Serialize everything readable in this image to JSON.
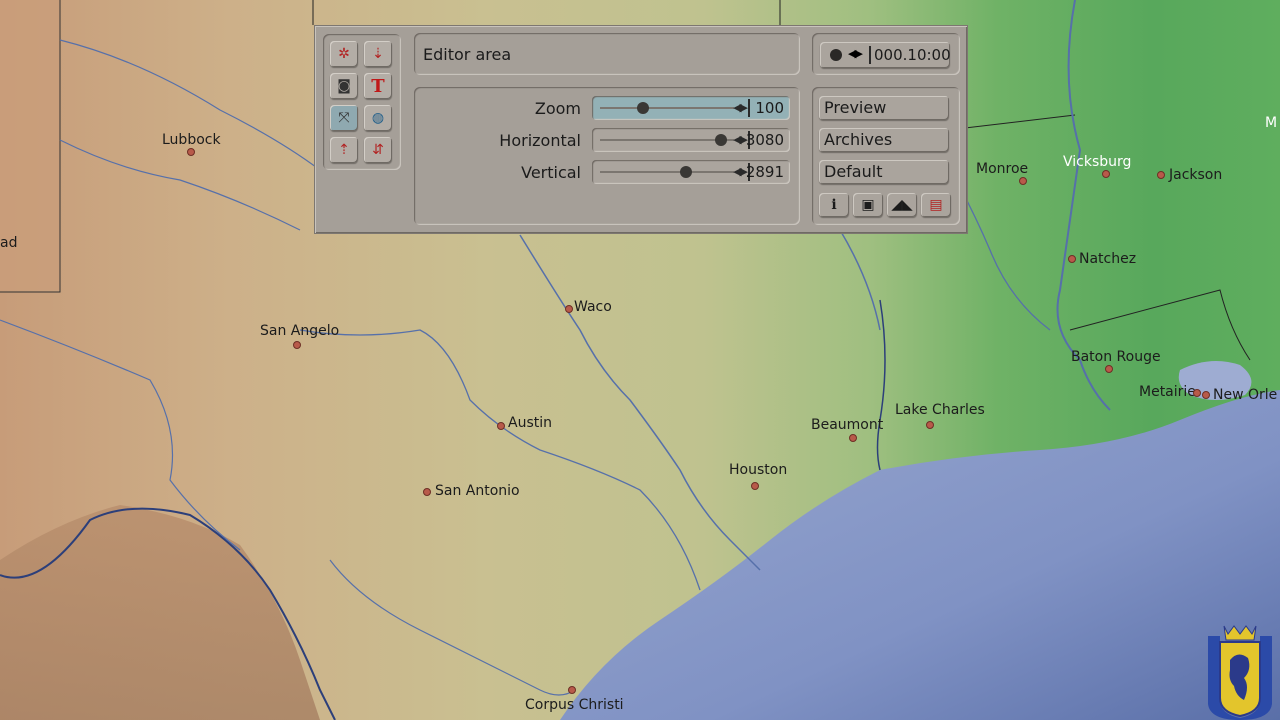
{
  "editor": {
    "title": "Editor area",
    "timecode": "000.10:00",
    "sliders": [
      {
        "label": "Zoom",
        "value": "100",
        "level": 0.32
      },
      {
        "label": "Horizontal",
        "value": "3080",
        "level": 0.9
      },
      {
        "label": "Vertical",
        "value": "2891",
        "level": 0.64
      }
    ],
    "buttons": {
      "preview": "Preview",
      "archives": "Archives",
      "default": "Default"
    },
    "tools": [
      "settings-icon",
      "pin-move-icon",
      "camera-icon",
      "text-t-icon",
      "crop-icon",
      "globe-icon",
      "add-pin-icon",
      "move-pin-icon"
    ],
    "bottom_icons": [
      "info-icon",
      "frame-icon",
      "triangle-icon",
      "toolbox-icon"
    ]
  },
  "map": {
    "cities": [
      "Lubbock",
      "Waco",
      "San Angelo",
      "Austin",
      "San Antonio",
      "Houston",
      "Beaumont",
      "Lake Charles",
      "Monroe",
      "Vicksburg",
      "Jackson",
      "Natchez",
      "Baton Rouge",
      "Metairie",
      "New Orle",
      "Corpus Christi",
      "ad",
      "M"
    ]
  },
  "colors": {
    "panel": "#a59f98",
    "slider_active": "#93b1b6",
    "sea": "#8a9ccc",
    "land_west": "#c8a27e",
    "land_east": "#5fae5e"
  }
}
